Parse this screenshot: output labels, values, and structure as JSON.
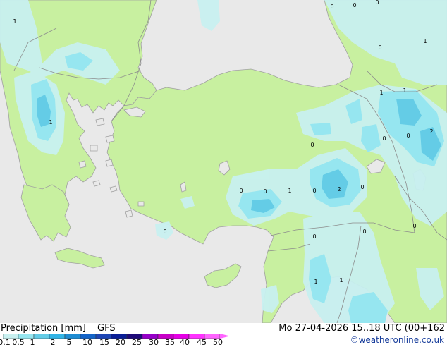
{
  "title": "Precipitation [mm]",
  "model": "GFS",
  "valid": "Mo 27-04-2026 15..18 UTC (00+162",
  "credit": "©weatheronline.co.uk",
  "colors": {
    "sea": "#e9e9e9",
    "land_dry": "#c8f0a0",
    "land_wet": "#aaf0aa",
    "coast": "#a0a0a0",
    "border": "#8c8c8c",
    "precip_light": "#c8f0f0",
    "precip_mid": "#96e6f0",
    "precip_heavy": "#64cce6"
  },
  "legend": {
    "colors": [
      "#c8f0f0",
      "#96e6f0",
      "#64cce6",
      "#32b4e6",
      "#1e8cd2",
      "#1464c8",
      "#1e46b4",
      "#0a1e96",
      "#1e0a78",
      "#9600c8",
      "#c800c8",
      "#e600e6",
      "#ff32ff",
      "#ff64ff"
    ],
    "ticks": [
      "0.1",
      "0.5",
      "1",
      "2",
      "5",
      "10",
      "15",
      "20",
      "25",
      "30",
      "35",
      "40",
      "45",
      "50"
    ]
  },
  "map_labels": [
    "1",
    "1",
    "0",
    "0",
    "0",
    "1",
    "0",
    "1",
    "1",
    "0",
    "2",
    "0",
    "0",
    "0",
    "1",
    "0",
    "2",
    "0",
    "0",
    "0",
    "0",
    "0",
    "1",
    "1",
    "0"
  ]
}
